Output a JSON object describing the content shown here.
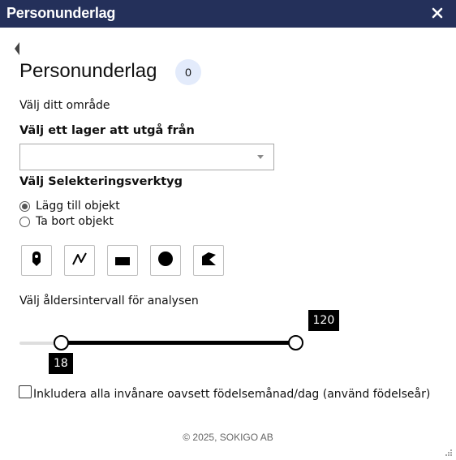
{
  "window": {
    "title": "Personunderlag"
  },
  "panel": {
    "heading": "Personunderlag",
    "count": "0",
    "area_label": "Välj ditt område",
    "layer_label": "Välj ett lager att utgå från",
    "layer_select_value": "",
    "tools_label": "Välj Selekteringsverktyg",
    "radio_add": "Lägg till objekt",
    "radio_remove": "Ta bort objekt",
    "radio_selected": "add",
    "tools": [
      "point-marker-icon",
      "polyline-icon",
      "rectangle-icon",
      "circle-icon",
      "polygon-icon"
    ],
    "age_label": "Välj åldersintervall för analysen",
    "age_min": "18",
    "age_max": "120",
    "age_range_min": 0,
    "age_range_max": 120,
    "include_label": "Inkludera alla invånare oavsett födelsemånad/dag (använd födelseår)",
    "include_checked": false
  },
  "footer": {
    "copyright": "© 2025, SOKIGO AB"
  },
  "colors": {
    "titlebar": "#24305a",
    "badge": "#e3ebfb",
    "slider": "#000000"
  }
}
